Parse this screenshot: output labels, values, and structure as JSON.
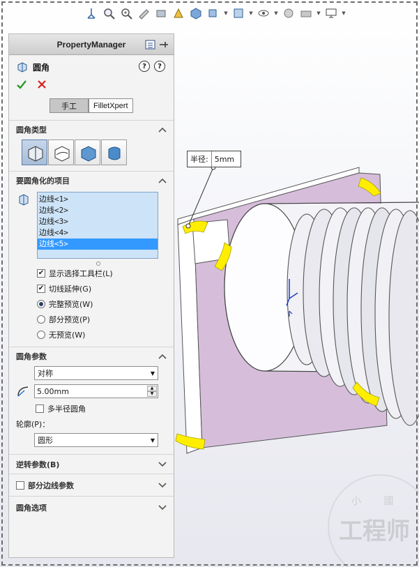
{
  "panel": {
    "title": "PropertyManager",
    "feature_name": "圆角",
    "help_question": "?",
    "tabs": [
      {
        "label": "手工"
      },
      {
        "label": "FilletXpert"
      }
    ]
  },
  "fillet_type": {
    "heading": "圆角类型"
  },
  "items": {
    "heading": "要圆角化的项目",
    "list": [
      "边线<1>",
      "边线<2>",
      "边线<3>",
      "边线<4>",
      "边线<5>"
    ],
    "selected_index": 4,
    "options": {
      "show_toolbar": {
        "label": "显示选择工具栏(L)",
        "checked": true
      },
      "tangent_propagation": {
        "label": "切线延伸(G)",
        "checked": true
      }
    },
    "preview": [
      {
        "label": "完整预览(W)",
        "checked": true
      },
      {
        "label": "部分预览(P)",
        "checked": false
      },
      {
        "label": "无预览(W)",
        "checked": false
      }
    ]
  },
  "params": {
    "heading": "圆角参数",
    "method_value": "对称",
    "radius_value": "5.00mm",
    "multi_radius_label": "多半径圆角",
    "profile_label": "轮廓(P)：",
    "profile_value": "圆形"
  },
  "collapsed_groups": {
    "setback": "逆转参数(B)",
    "partial_edge": "部分边线参数",
    "fillet_options": "圆角选项"
  },
  "callout": {
    "label": "半径:",
    "value": "5mm"
  },
  "watermark": {
    "small": "小 國",
    "large": "工程师"
  },
  "colors": {
    "face": "#d6bedb",
    "preview": "#ffee00",
    "selection": "#3399ff",
    "list_bg": "#cde3f7"
  }
}
